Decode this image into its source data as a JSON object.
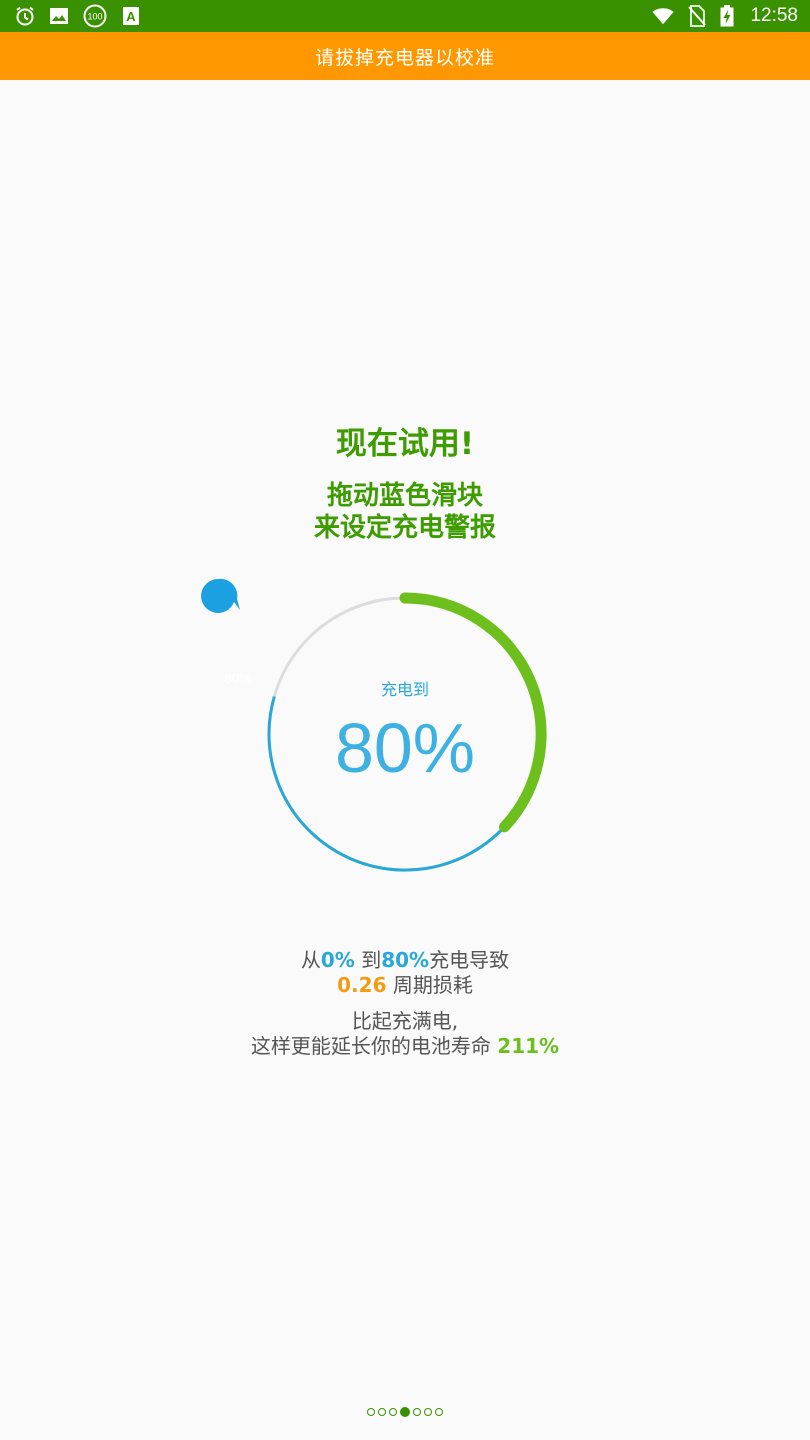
{
  "status_bar": {
    "time": "12:58",
    "left_icons": [
      "alarm-icon",
      "image-icon",
      "badge-100-icon",
      "text-a-icon"
    ],
    "badge_text": "100",
    "a_text": "A",
    "right_icons": [
      "wifi-icon",
      "no-sim-icon",
      "battery-charging-icon"
    ]
  },
  "banner": {
    "text": "请拔掉充电器以校准"
  },
  "intro": {
    "headline": "现在试用!",
    "line1": "拖动蓝色滑块",
    "line2": "来设定充电警报"
  },
  "gauge": {
    "label": "充电到",
    "value_text": "80%",
    "knob_text": "80%",
    "charge_level_percent": 80,
    "colors": {
      "green": "#6cbf1c",
      "blue": "#29a8d8",
      "track": "#dddddd"
    }
  },
  "info": {
    "from_prefix": "从",
    "from_value": "0%",
    "to_prefix": " 到",
    "to_value": "80%",
    "to_suffix": "充电导致",
    "cycle_value": "0.26",
    "cycle_suffix": " 周期损耗",
    "compare_line": "比起充满电,",
    "life_prefix": "这样更能延长你的电池寿命 ",
    "life_value": "211%"
  },
  "pager": {
    "count": 7,
    "active_index": 3
  },
  "colors": {
    "status_bar": "#3a9100",
    "banner": "#ff9800",
    "accent_green": "#3c9c00"
  }
}
